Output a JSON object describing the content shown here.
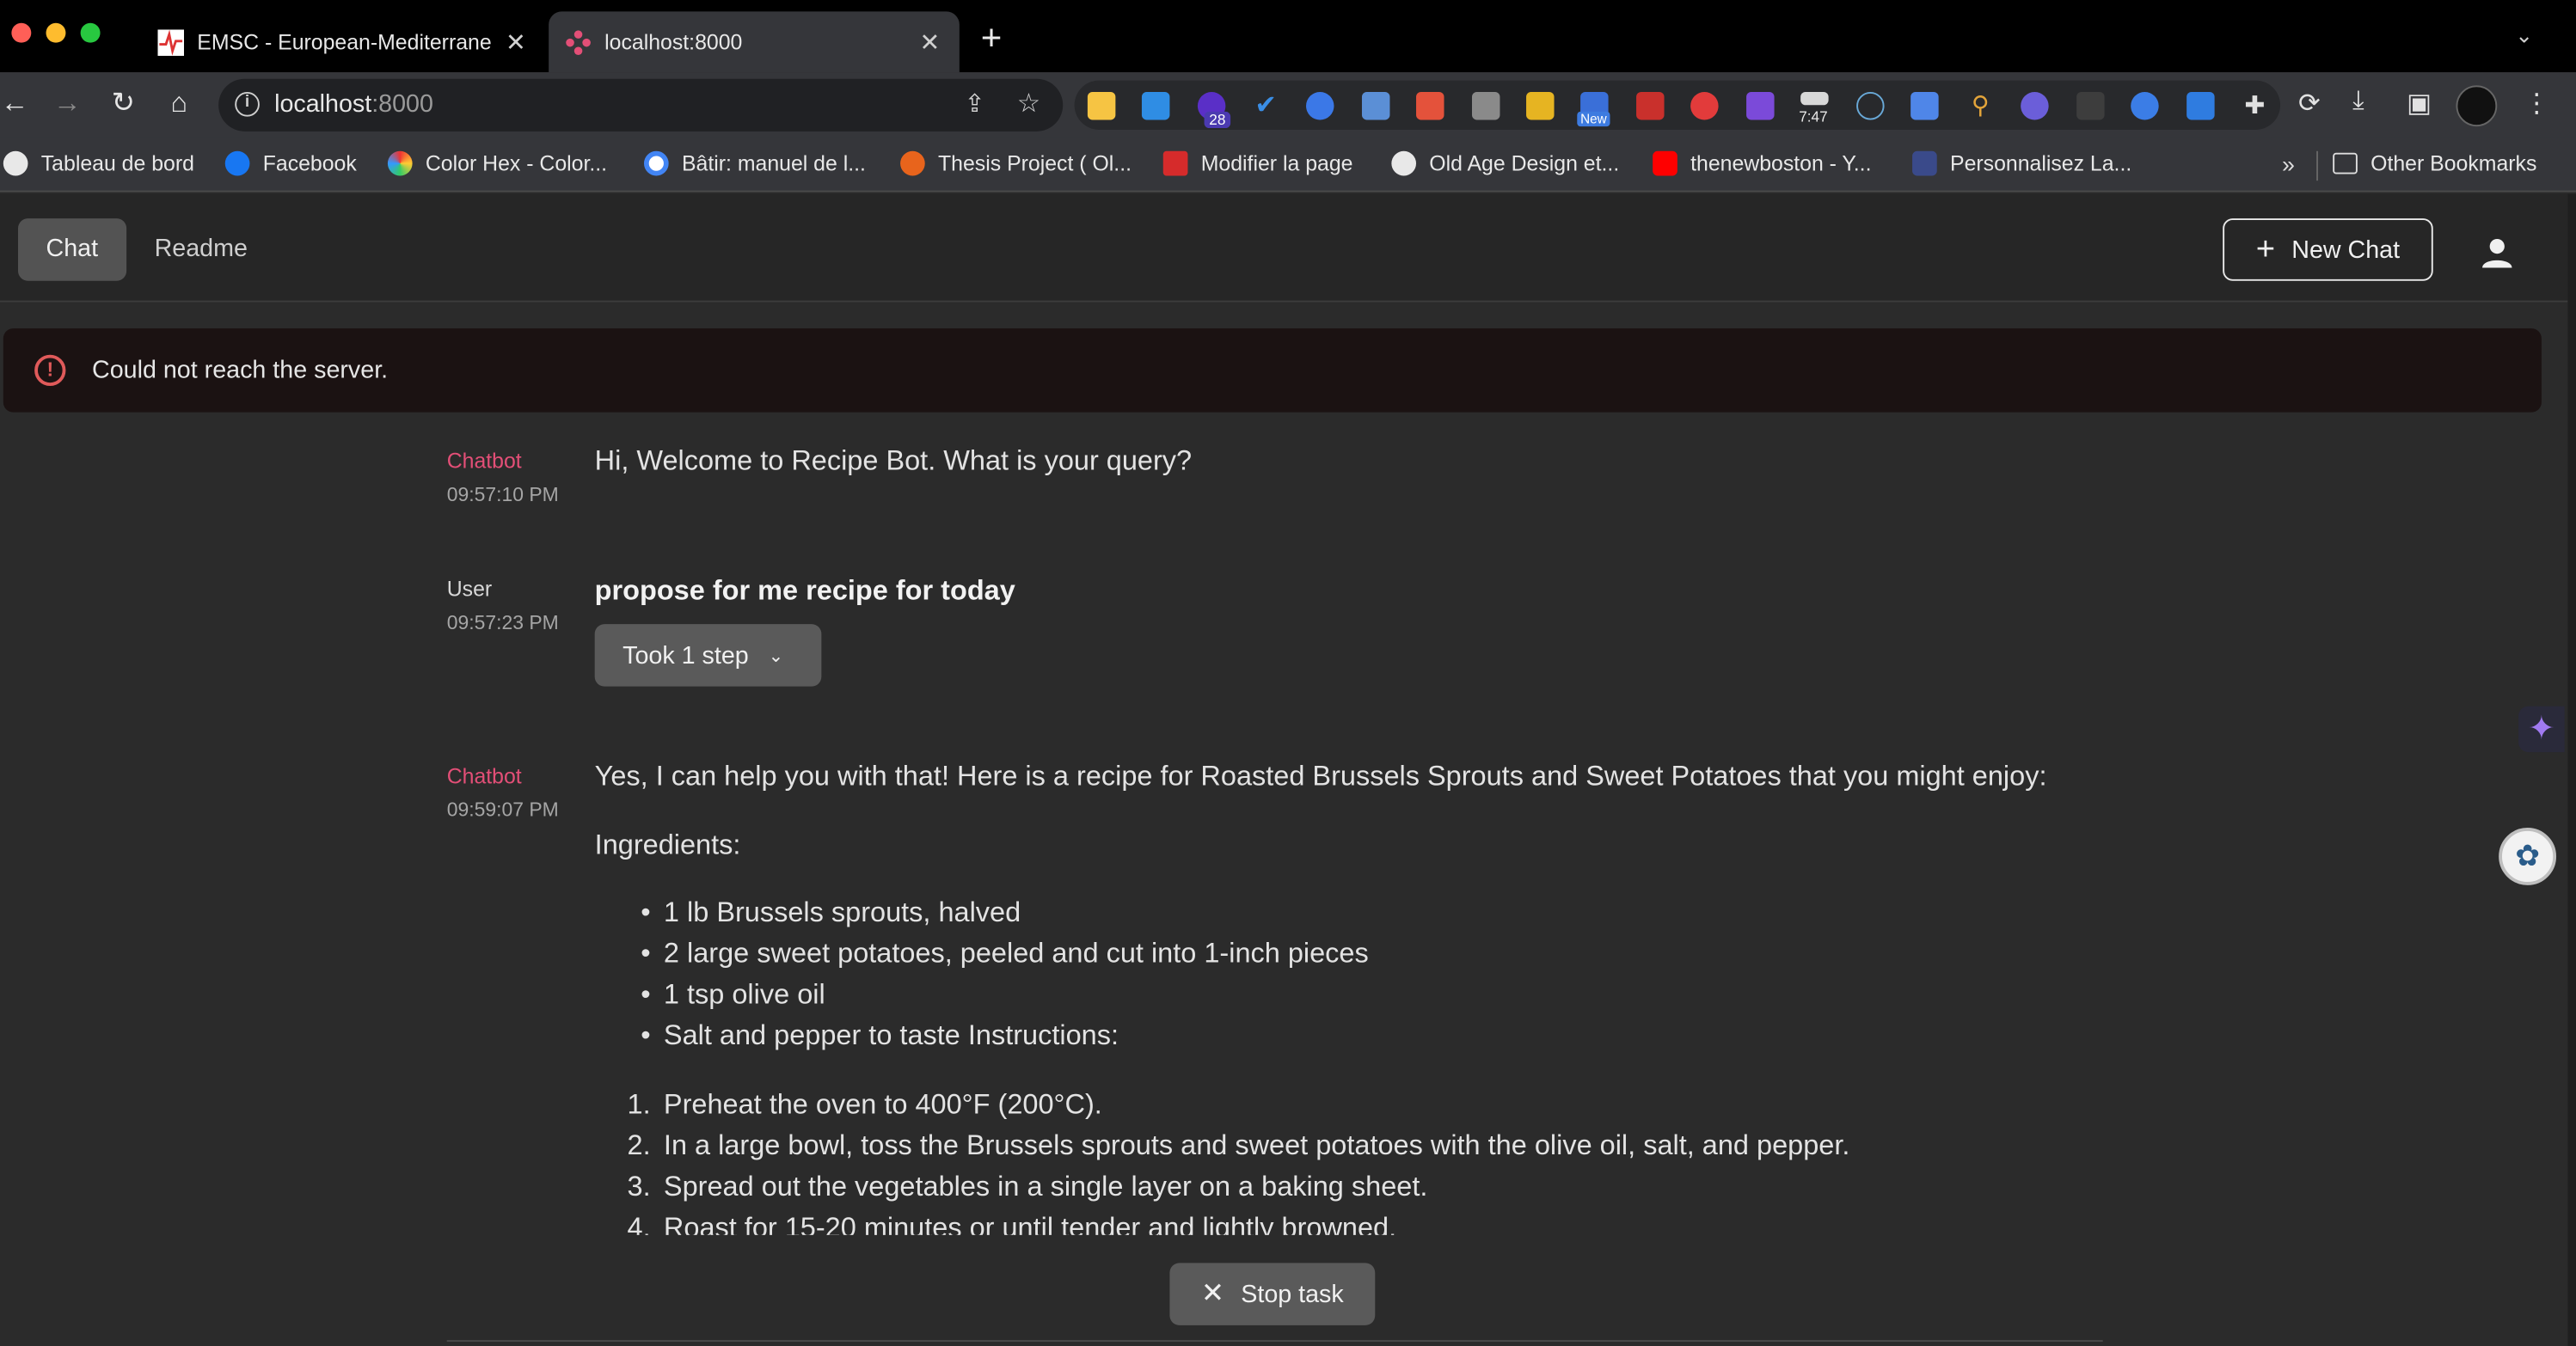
{
  "browser": {
    "tabs": [
      {
        "title": "EMSC - European-Mediterrane",
        "active": false
      },
      {
        "title": "localhost:8000",
        "active": true
      }
    ],
    "url": {
      "host": "localhost",
      "port": ":8000"
    },
    "extension_badges": {
      "count": "28",
      "new": "New",
      "time": "7:47"
    },
    "bookmarks": [
      "Tableau de bord",
      "Facebook",
      "Color Hex - Color...",
      "Bâtir: manuel de l...",
      "Thesis Project ( Ol...",
      "Modifier la page",
      "Old Age Design et...",
      "thenewboston - Y...",
      "Personnalisez La..."
    ],
    "overflow": "»",
    "other_bookmarks": "Other Bookmarks"
  },
  "app": {
    "nav": {
      "chat": "Chat",
      "readme": "Readme"
    },
    "new_chat": "New Chat",
    "alert": "Could not reach the server.",
    "messages": [
      {
        "author": "Chatbot",
        "time": "09:57:10 PM",
        "text": "Hi, Welcome to Recipe Bot. What is your query?"
      },
      {
        "author": "User",
        "time": "09:57:23 PM",
        "text": "propose for me recipe for today",
        "steps": "Took 1 step"
      },
      {
        "author": "Chatbot",
        "time": "09:59:07 PM",
        "intro": "Yes, I can help you with that! Here is a recipe for Roasted Brussels Sprouts and Sweet Potatoes that you might enjoy:",
        "ingredients_label": "Ingredients:",
        "ingredients": [
          "1 lb Brussels sprouts, halved",
          "2 large sweet potatoes, peeled and cut into 1-inch pieces",
          "1 tsp olive oil",
          "Salt and pepper to taste Instructions:"
        ],
        "steps_list": [
          "Preheat the oven to 400°F (200°C).",
          "In a large bowl, toss the Brussels sprouts and sweet potatoes with the olive oil, salt, and pepper.",
          "Spread out the vegetables in a single layer on a baking sheet.",
          "Roast for 15-20 minutes or until tender and lightly browned."
        ]
      }
    ],
    "stop_task": "Stop task"
  },
  "colors": {
    "accent_author": "#e34f77",
    "alert_icon": "#e05a5a",
    "button_bg": "#5a5a5a"
  }
}
